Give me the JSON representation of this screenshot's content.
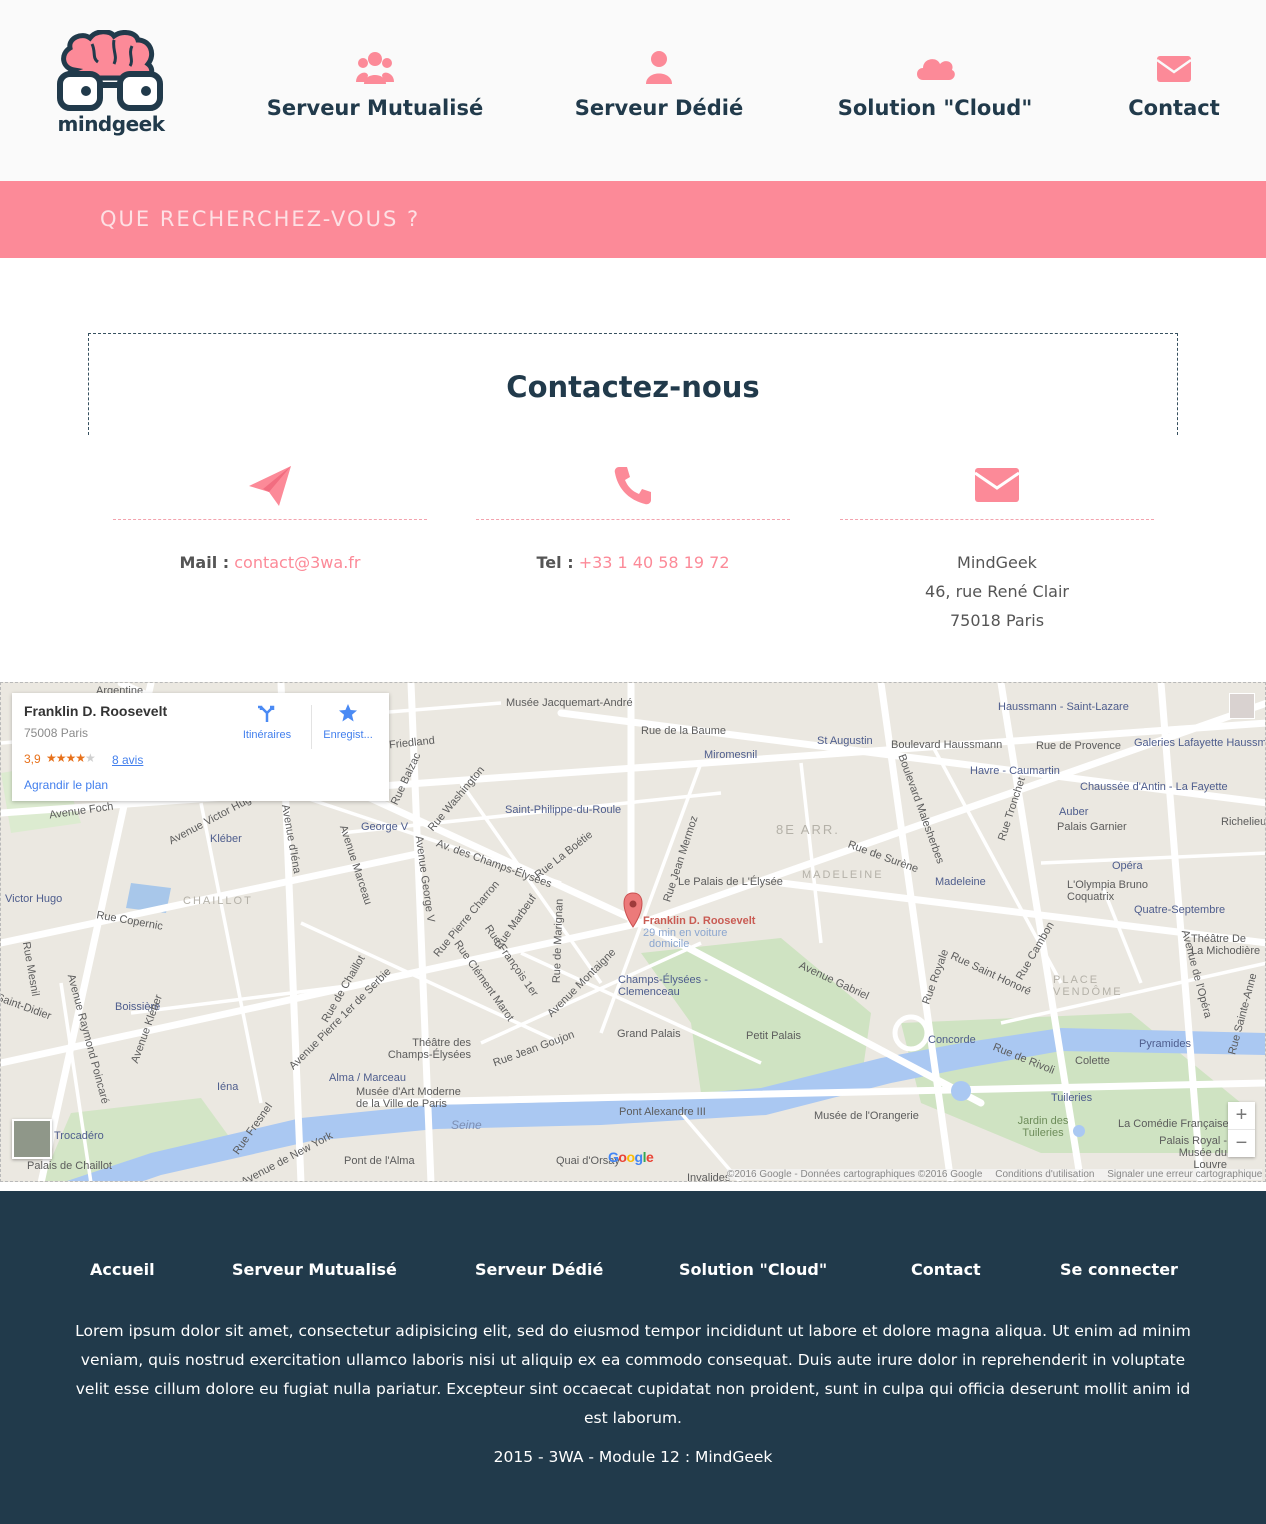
{
  "brand": {
    "name": "mindgeek",
    "primary": "#213a4b",
    "accent": "#fc8a98"
  },
  "nav": [
    {
      "label": "Serveur Mutualisé",
      "icon": "users-icon"
    },
    {
      "label": "Serveur Dédié",
      "icon": "user-icon"
    },
    {
      "label": "Solution \"Cloud\"",
      "icon": "cloud-icon"
    },
    {
      "label": "Contact",
      "icon": "envelope-icon"
    }
  ],
  "search": {
    "placeholder": "QUE RECHERCHEZ-VOUS ?"
  },
  "contact": {
    "title": "Contactez-nous",
    "mail": {
      "label": "Mail :",
      "value": "contact@3wa.fr",
      "icon": "paper-plane-icon"
    },
    "tel": {
      "label": "Tel :",
      "value": "+33 1 40 58 19 72",
      "icon": "phone-icon"
    },
    "address": {
      "icon": "envelope-icon",
      "lines": [
        "MindGeek",
        "46, rue René Clair",
        "75018 Paris"
      ]
    }
  },
  "map": {
    "place": {
      "name": "Franklin D. Roosevelt",
      "address": "75008 Paris",
      "rating": "3,9",
      "stars": 4,
      "reviews": "8 avis",
      "enlarge": "Agrandir le plan",
      "directions": "Itinéraires",
      "save": "Enregist..."
    },
    "marker": {
      "name": "Franklin D. Roosevelt",
      "sub1": "29 min en voiture",
      "sub2": "domicile"
    },
    "labels": [
      "Argentine",
      "Musée Jacquemart-André",
      "Haussmann - Saint-Lazare",
      "Rue de la Baume",
      "Miromesnil",
      "St Augustin",
      "Boulevard Haussmann",
      "Rue de Provence",
      "Galeries Lafayette Haussmann",
      "Havre - Caumartin",
      "Chaussée d'Antin - La Fayette",
      "Auber",
      "Palais Garnier",
      "Richelieu",
      "Saint-Philippe-du-Roule",
      "George V",
      "Kléber",
      "8E ARR.",
      "Rue de Surène",
      "Opéra",
      "Le Palais de L'Élysée",
      "MADELEINE",
      "Madeleine",
      "L'Olympia Bruno Coquatrix",
      "Victor Hugo",
      "CHAILLOT",
      "Rue Copernic",
      "Quatre-Septembre",
      "Théâtre De La Michodière",
      "Champs-Élysées - Clemenceau",
      "PLACE VENDÔME",
      "Boissière",
      "Grand Palais",
      "Petit Palais",
      "Concorde",
      "Pyramides",
      "Colette",
      "Théâtre des Champs-Élysées",
      "Alma / Marceau",
      "Musée d'Art Moderne de la Ville de Paris",
      "Iéna",
      "Pont Alexandre III",
      "Musée de l'Orangerie",
      "Tuileries",
      "Jardin des Tuileries",
      "La Comédie Française",
      "Palais Royal - Musée du Louvre",
      "Seine",
      "Pont de l'Alma",
      "Quai d'Orsay",
      "Palais de Chaillot",
      "Trocadéro",
      "Invalides",
      "Avenue Foch",
      "Avenue Victor Hugo",
      "Avenue Marceau",
      "Avenue George V",
      "Av. des Champs-Élysées",
      "Rue La Boétie",
      "Rue Pierre Charron",
      "Rue Marbeuf",
      "Avenue Montaigne",
      "Avenue Gabriel",
      "Rue Royale",
      "Rue Saint Honoré",
      "Rue Cambon",
      "Rue de Rivoli",
      "Avenue de l'Opéra",
      "Rue Sainte-Anne",
      "Rue Tronchet",
      "Boulevard Malesherbes",
      "Rue Jean Mermoz",
      "Avenue Kléber",
      "Avenue Raymond Poincaré",
      "Rue Fresnel",
      "Avenue de New York",
      "Rue Jean Goujon",
      "Rue Clément Marot",
      "Rue François 1er",
      "Rue de Marignan",
      "Avenue Pierre 1er de Serbie",
      "Rue de Chaillot",
      "Rue Balzac",
      "Rue Washington",
      "Avenue d'Iéna",
      "Rue Mesnil",
      "Saint-Didier",
      "Friedland"
    ],
    "zoom_in": "+",
    "zoom_out": "−",
    "google": "Google",
    "attribution": "©2016 Google - Données cartographiques ©2016 Google",
    "terms": "Conditions d'utilisation",
    "report": "Signaler une erreur cartographique"
  },
  "footer": {
    "nav": [
      "Accueil",
      "Serveur Mutualisé",
      "Serveur Dédié",
      "Solution \"Cloud\"",
      "Contact",
      "Se connecter"
    ],
    "text": "Lorem ipsum dolor sit amet, consectetur adipisicing elit, sed do eiusmod tempor incididunt ut labore et dolore magna aliqua. Ut enim ad minim veniam, quis nostrud exercitation ullamco laboris nisi ut aliquip ex ea commodo consequat. Duis aute irure dolor in reprehenderit in voluptate velit esse cillum dolore eu fugiat nulla pariatur. Excepteur sint occaecat cupidatat non proident, sunt in culpa qui officia deserunt mollit anim id est laborum.",
    "copyright": "2015 - 3WA - Module 12 : MindGeek"
  }
}
